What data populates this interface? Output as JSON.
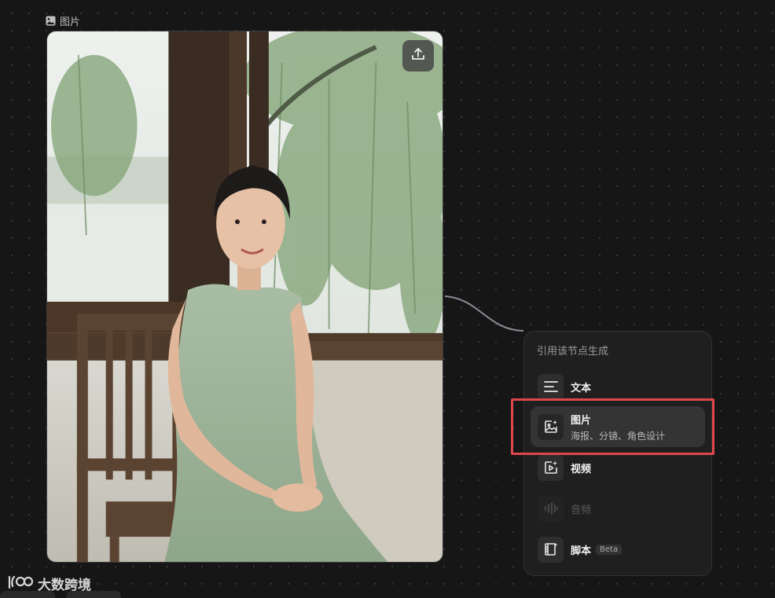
{
  "node": {
    "label": "图片"
  },
  "panel": {
    "title": "引用该节点生成",
    "items": [
      {
        "label": "文本",
        "icon": "text-lines-icon"
      },
      {
        "label": "图片",
        "sub": "海报、分镜、角色设计",
        "icon": "image-sparkle-icon",
        "selected": true
      },
      {
        "label": "视频",
        "icon": "video-sparkle-icon"
      },
      {
        "label": "音频",
        "icon": "audio-wave-icon",
        "disabled": true
      },
      {
        "label": "脚本",
        "badge": "Beta",
        "icon": "film-script-icon"
      }
    ]
  },
  "watermark": {
    "text": "大数跨境"
  },
  "colors": {
    "highlight": "#e0474c",
    "background": "#161616",
    "panel": "#1f1f1f"
  }
}
